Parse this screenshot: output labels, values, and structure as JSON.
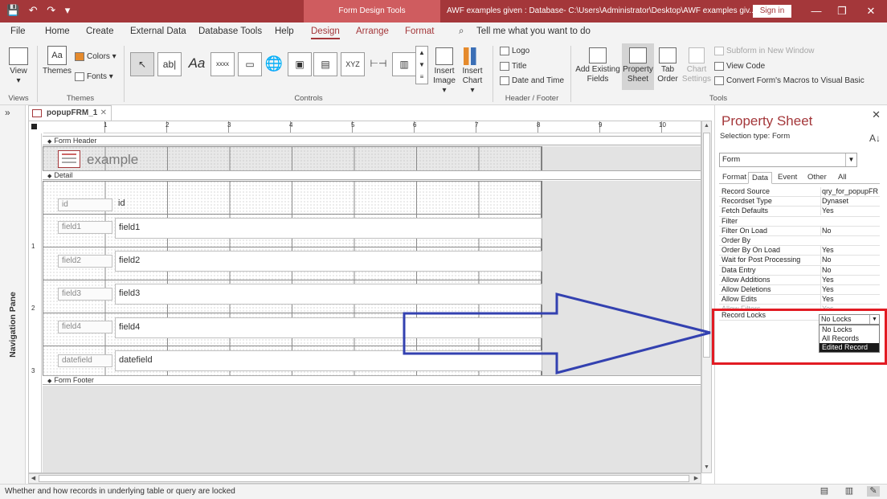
{
  "titlebar": {
    "context_label": "Form Design Tools",
    "title": "AWF examples given : Database- C:\\Users\\Administrator\\Desktop\\AWF examples giv...",
    "signin": "Sign in",
    "quick_access": "💾 ↶ ↷ ▾"
  },
  "tabs": [
    "File",
    "Home",
    "Create",
    "External Data",
    "Database Tools",
    "Help",
    "Design",
    "Arrange",
    "Format"
  ],
  "tell_me": "Tell me what you want to do",
  "ribbon": {
    "views": {
      "view": "View",
      "group": "Views"
    },
    "themes": {
      "themes": "Themes",
      "colors": "Colors ▾",
      "fonts": "Fonts ▾",
      "group": "Themes"
    },
    "controls": {
      "group": "Controls",
      "insert_image": "Insert Image ▾",
      "insert_chart": "Insert Chart ▾"
    },
    "header_footer": {
      "logo": "Logo",
      "title": "Title",
      "date_time": "Date and Time",
      "group": "Header / Footer"
    },
    "tools": {
      "add_existing_fields": "Add Existing Fields",
      "property_sheet": "Property Sheet",
      "tab_order": "Tab Order",
      "chart_settings": "Chart Settings",
      "subform_new_window": "Subform in New Window",
      "view_code": "View Code",
      "convert_macros": "Convert Form's Macros to Visual Basic",
      "group": "Tools"
    }
  },
  "nav_pane": {
    "label": "Navigation Pane",
    "toggle": "»"
  },
  "document": {
    "tab_name": "popupFRM_1",
    "sections": {
      "header": "Form Header",
      "detail": "Detail",
      "footer": "Form Footer"
    },
    "header_title": "example",
    "fields": [
      {
        "label": "id",
        "value": "id"
      },
      {
        "label": "field1",
        "value": "field1"
      },
      {
        "label": "field2",
        "value": "field2"
      },
      {
        "label": "field3",
        "value": "field3"
      },
      {
        "label": "field4",
        "value": "field4"
      },
      {
        "label": "datefield",
        "value": "datefield"
      }
    ],
    "ruler_marks": [
      "1",
      "2",
      "3",
      "4",
      "5",
      "6",
      "7",
      "8",
      "9",
      "10"
    ],
    "vruler_marks": [
      "1",
      "2",
      "3"
    ]
  },
  "property_sheet": {
    "title": "Property Sheet",
    "selection_type": "Selection type:  Form",
    "selected_object": "Form",
    "tabs": [
      "Format",
      "Data",
      "Event",
      "Other",
      "All"
    ],
    "active_tab": "Data",
    "rows": [
      {
        "name": "Record Source",
        "value": "qry_for_popupFR"
      },
      {
        "name": "Recordset Type",
        "value": "Dynaset"
      },
      {
        "name": "Fetch Defaults",
        "value": "Yes"
      },
      {
        "name": "Filter",
        "value": ""
      },
      {
        "name": "Filter On Load",
        "value": "No"
      },
      {
        "name": "Order By",
        "value": ""
      },
      {
        "name": "Order By On Load",
        "value": "Yes"
      },
      {
        "name": "Wait for Post Processing",
        "value": "No"
      },
      {
        "name": "Data Entry",
        "value": "No"
      },
      {
        "name": "Allow Additions",
        "value": "Yes"
      },
      {
        "name": "Allow Deletions",
        "value": "Yes"
      },
      {
        "name": "Allow Edits",
        "value": "Yes"
      },
      {
        "name": "Allow Filters",
        "value": "Yes"
      },
      {
        "name": "Record Locks",
        "value": "No Locks"
      }
    ],
    "dropdown_options": [
      "No Locks",
      "All Records",
      "Edited Record"
    ],
    "dropdown_highlighted": "Edited Record"
  },
  "status_bar": {
    "message": "Whether and how records in underlying table or query are locked"
  },
  "annotation": {
    "arrow_color": "#3341b0",
    "box_color": "#e21b23"
  },
  "colors": {
    "accent": "#a4373a"
  }
}
